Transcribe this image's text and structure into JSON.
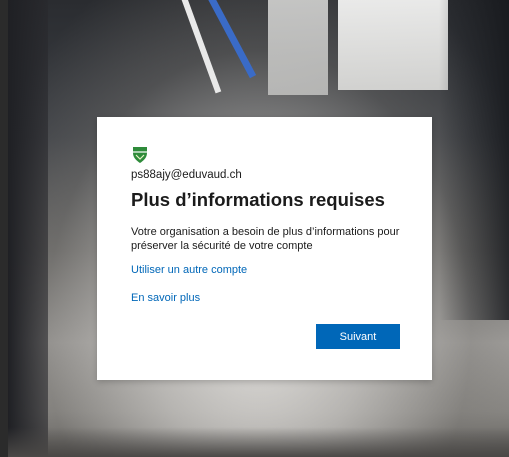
{
  "dialog": {
    "logo_icon": "school-shield-logo-icon",
    "email": "ps88ajy@eduvaud.ch",
    "title": "Plus d’informations requises",
    "description": "Votre organisation a besoin de plus d’informations pour préserver la sécurité de votre compte",
    "link_other_account": "Utiliser un autre compte",
    "link_learn_more": "En savoir plus",
    "next_button": "Suivant"
  },
  "colors": {
    "accent": "#0067b8",
    "logo_green": "#2e8b3a",
    "text": "#1b1b1b"
  }
}
